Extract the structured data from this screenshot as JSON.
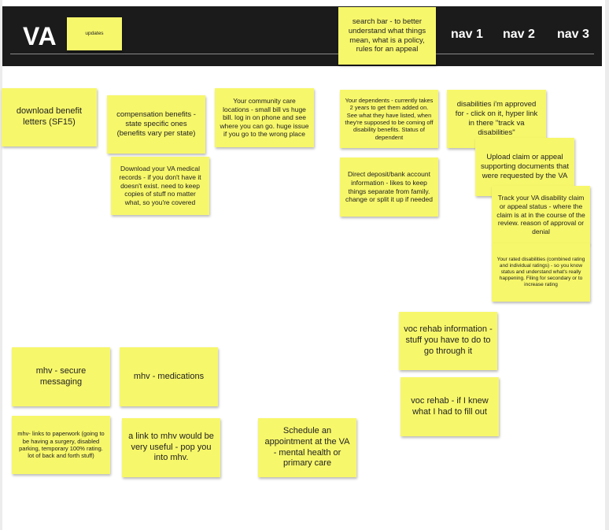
{
  "header": {
    "logo": "VA",
    "nav": [
      "nav 1",
      "nav 2",
      "nav 3"
    ]
  },
  "stickies": {
    "updates": "updates",
    "search_bar": "search bar - to better understand what things mean, what is a policy, rules for an appeal",
    "download_benefit_letters": "download benefit letters (SF15)",
    "compensation_benefits": "compensation benefits - state specific ones (benefits vary per state)",
    "download_medical_records": "Download your VA medical records - if you don't have it doesn't exist. need to keep copies of stuff no matter what, so you're covered",
    "community_care": "Your community care locations - small bill vs huge bill. log in on phone and see where you can go. huge issue if you go to the wrong place",
    "dependents": "Your dependents - currently takes 2 years to get them added on. See what they have listed, when they're supposed to be coming off disability benefits.  Status of dependent",
    "direct_deposit": "Direct deposit/bank account information - likes to keep things separate from family. change or split it up if needed",
    "disabilities_approved": "disabilities i'm approved for - click on it, hyper link in there \"track va disabilities\"",
    "upload_claim": "Upload claim or appeal supporting documents that were requested by the VA",
    "track_claim": "Track your VA disability claim or appeal status - where the claim is at in the course of the review. reason of approval or denial",
    "rated_disabilities": "Your rated disabilities (combined rating and individual ratings) - so you know status and understand what's really happening. Filing for secondary or to increase rating",
    "voc_rehab_info": "voc rehab information - stuff you have to do to go through it",
    "voc_rehab_fill_out": "voc rehab - if I knew what I had to fill out",
    "mhv_secure_messaging": "mhv - secure messaging",
    "mhv_medications": "mhv - medications",
    "mhv_links_paperwork": "mhv- links to paperwork (going to be having a surgery, disabled parking, temporary 100% rating. lot of back and forth stuff)",
    "link_to_mhv": "a link to mhv would be very useful - pop you into mhv.",
    "schedule_appointment": "Schedule an appointment at the VA - mental health or primary care"
  },
  "colors": {
    "sticky": "#f7f76b",
    "header": "#1b1b1b",
    "background": "#ececec"
  }
}
